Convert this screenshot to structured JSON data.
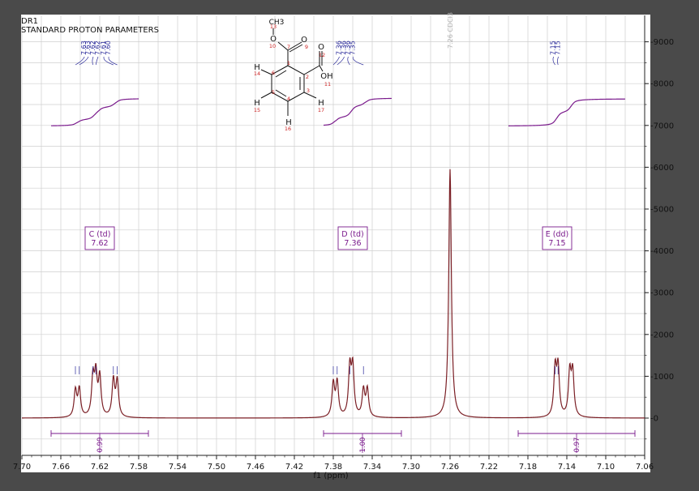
{
  "header": {
    "dataset": "DR1",
    "title": "STANDARD PROTON PARAMETERS"
  },
  "chart_data": {
    "type": "line",
    "title": "",
    "xlabel": "f1 (ppm)",
    "ylabel": "",
    "xlim": [
      7.7,
      7.06
    ],
    "ylim": [
      -1000,
      9500
    ],
    "x_ticks": [
      "7.70",
      "7.66",
      "7.62",
      "7.58",
      "7.54",
      "7.50",
      "7.46",
      "7.42",
      "7.38",
      "7.34",
      "7.30",
      "7.26",
      "7.22",
      "7.18",
      "7.14",
      "7.10",
      "7.06"
    ],
    "y_ticks": [
      "9000",
      "8000",
      "7000",
      "6000",
      "5000",
      "4000",
      "3000",
      "2000",
      "1000",
      "0"
    ],
    "grid": true,
    "colors": {
      "spectrum": "#7b1f25",
      "integral": "#7a1a8c",
      "peaklabel": "#2a2a9a",
      "solvent": "#b0b0b0",
      "structure_num": "#cc2222"
    },
    "peaks": [
      {
        "ppm": 7.645,
        "height": 640
      },
      {
        "ppm": 7.641,
        "height": 660
      },
      {
        "ppm": 7.627,
        "height": 920
      },
      {
        "ppm": 7.624,
        "height": 960
      },
      {
        "ppm": 7.62,
        "height": 940
      },
      {
        "ppm": 7.606,
        "height": 880
      },
      {
        "ppm": 7.602,
        "height": 860
      },
      {
        "ppm": 7.38,
        "height": 800
      },
      {
        "ppm": 7.376,
        "height": 820
      },
      {
        "ppm": 7.363,
        "height": 1150
      },
      {
        "ppm": 7.36,
        "height": 1160
      },
      {
        "ppm": 7.349,
        "height": 640
      },
      {
        "ppm": 7.345,
        "height": 660
      },
      {
        "ppm": 7.26,
        "height": 5950
      },
      {
        "ppm": 7.152,
        "height": 1140
      },
      {
        "ppm": 7.149,
        "height": 1150
      },
      {
        "ppm": 7.137,
        "height": 1040
      },
      {
        "ppm": 7.134,
        "height": 1050
      }
    ],
    "peak_labels": [
      {
        "group": "C",
        "values": [
          "7.63",
          "7.63",
          "7.62",
          "7.62",
          "7.61",
          "7.60"
        ]
      },
      {
        "group": "D",
        "values": [
          "7.36",
          "7.36",
          "7.36",
          "7.35"
        ]
      },
      {
        "group": "E",
        "values": [
          "7.15",
          "7.15"
        ]
      }
    ],
    "solvent_label": "7.26 CDCl3",
    "multiplets": [
      {
        "label": "C (td)",
        "shift": "7.62",
        "ppm": 7.62,
        "integral": "0.99",
        "range": [
          7.67,
          7.57
        ]
      },
      {
        "label": "D (td)",
        "shift": "7.36",
        "ppm": 7.36,
        "integral": "1.00",
        "range": [
          7.39,
          7.31
        ]
      },
      {
        "label": "E (dd)",
        "shift": "7.15",
        "ppm": 7.15,
        "integral": "0.97",
        "range": [
          7.19,
          7.07
        ]
      }
    ],
    "integral_curves": [
      {
        "range": [
          7.67,
          7.58
        ],
        "start": 6980,
        "end": 7650
      },
      {
        "range": [
          7.39,
          7.32
        ],
        "start": 6980,
        "end": 7660
      },
      {
        "range": [
          7.2,
          7.08
        ],
        "start": 6980,
        "end": 7640
      }
    ]
  },
  "structure": {
    "methyl": "CH3",
    "ester_o": "O",
    "carbonyl_o1": "O",
    "carbonyl_o2": "O",
    "acid": "OH",
    "h_labels": [
      "H",
      "H",
      "H",
      "H"
    ],
    "numbers": [
      "13",
      "10",
      "7",
      "9",
      "12",
      "1",
      "2",
      "3",
      "4",
      "5",
      "6",
      "14",
      "15",
      "16",
      "17",
      "11"
    ]
  }
}
